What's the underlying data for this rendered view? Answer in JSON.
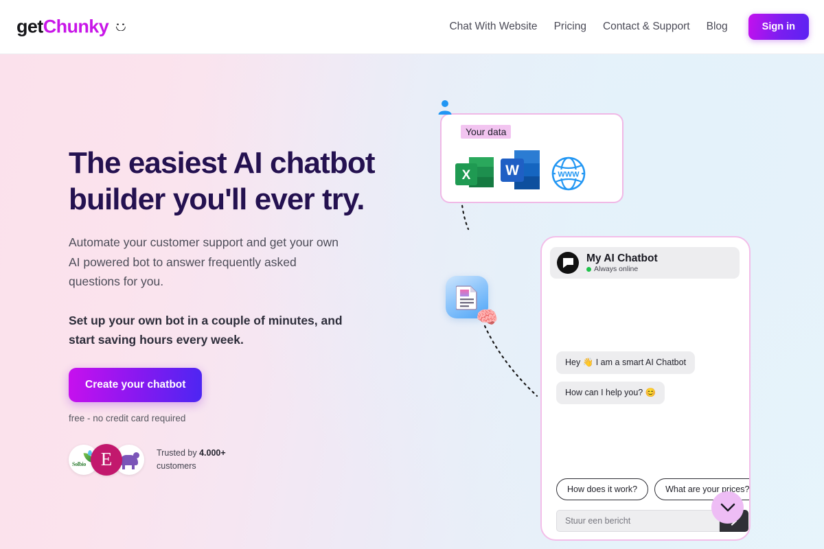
{
  "header": {
    "logo": {
      "part1": "get",
      "part2": "Chunky",
      "smiley_icon": "smiley-face-icon"
    },
    "nav_links": [
      {
        "label": "Chat With Website"
      },
      {
        "label": "Pricing"
      },
      {
        "label": "Contact & Support"
      },
      {
        "label": "Blog"
      }
    ],
    "signin_label": "Sign in"
  },
  "hero": {
    "headline_line1": "The easiest AI chatbot",
    "headline_line2": "builder you'll ever try.",
    "paragraph": "Automate your customer support and get your own AI powered bot to answer frequently asked questions for you.",
    "bold_paragraph": "Set up your own bot in a couple of minutes, and start saving hours every week.",
    "cta_label": "Create your chatbot",
    "free_note": "free - no credit card required",
    "trust": {
      "prefix": "Trusted by ",
      "count": "4.000+",
      "suffix": " customers",
      "logos": [
        {
          "name": "solbio-logo",
          "text": "Solbio"
        },
        {
          "name": "e-logo",
          "text": "E"
        },
        {
          "name": "bear-logo",
          "text": ""
        }
      ]
    }
  },
  "illustration": {
    "data_card": {
      "label": "Your data",
      "person_icon": "person-avatar-icon",
      "icons": [
        {
          "name": "excel-icon",
          "letter": "X"
        },
        {
          "name": "word-icon",
          "letter": "W"
        },
        {
          "name": "www-globe-icon",
          "letter": "WWW"
        }
      ]
    },
    "doc_node": {
      "icon": "document-icon",
      "brain_icon": "brain-emoji"
    }
  },
  "chat_widget": {
    "bot_name": "My AI Chatbot",
    "status": "Always online",
    "avatar_icon": "chat-bubble-avatar-icon",
    "messages": [
      {
        "text": "Hey 👋 I am a smart AI Chatbot"
      },
      {
        "text": "How can I help you? 😊"
      }
    ],
    "chips": [
      {
        "label": "How does it work?"
      },
      {
        "label": "What are your prices?"
      }
    ],
    "input_placeholder": "Stuur een bericht",
    "input_value": "",
    "send_icon": "send-arrow-icon"
  },
  "scroll_button": {
    "icon": "chevron-down-icon"
  },
  "colors": {
    "brand_magenta": "#c816e8",
    "brand_violet": "#5b23f2",
    "headline_navy": "#241150",
    "card_border_pink": "#f0b8e6",
    "online_green": "#1fc24a",
    "bg_pink": "#fbe1ec",
    "bg_blue": "#e7f4fb"
  }
}
